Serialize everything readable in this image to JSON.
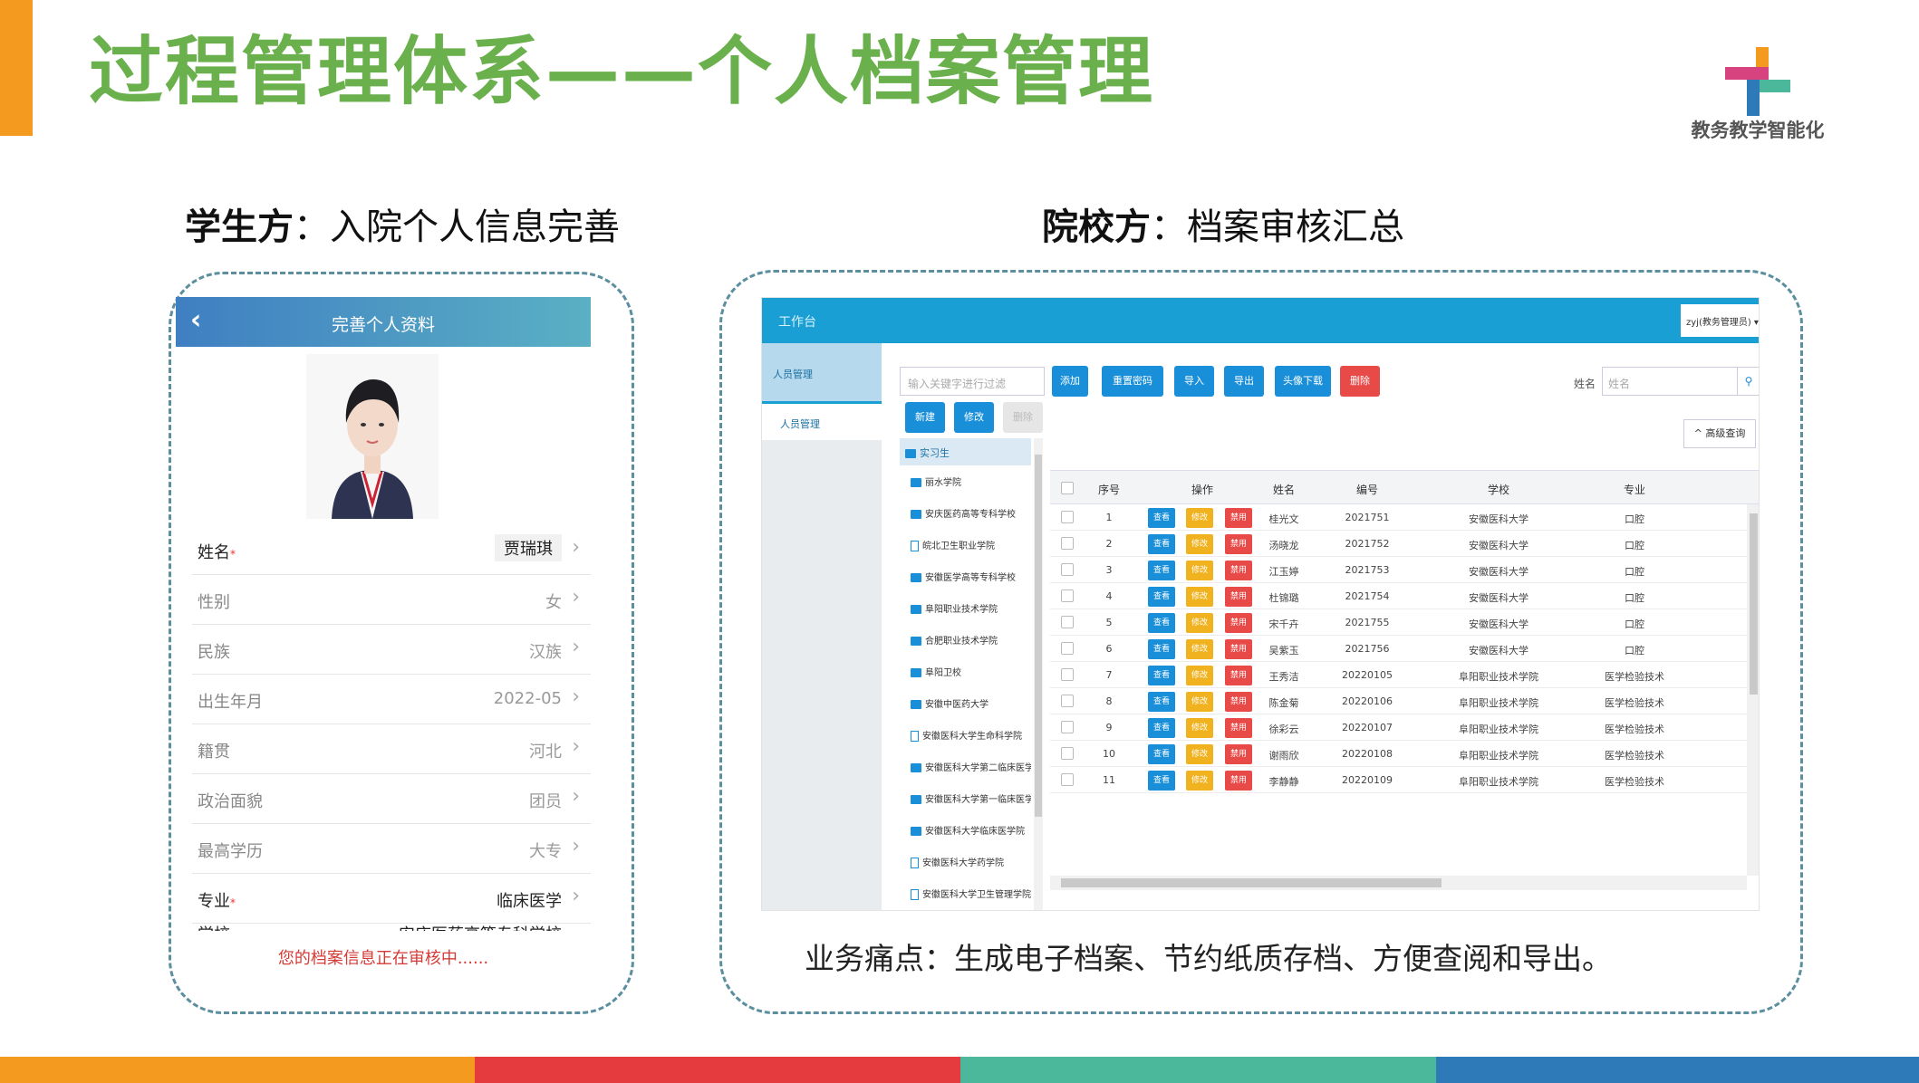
{
  "slide": {
    "title": "过程管理体系——个人档案管理",
    "logo_text": "教务教学智能化",
    "student_head_bold": "学生方",
    "student_head_rest": "：入院个人信息完善",
    "school_head_bold": "院校方",
    "school_head_rest": "：档案审核汇总",
    "pain_points": "业务痛点：生成电子档案、节约纸质存档、方便查阅和导出。",
    "accent_colors": [
      "#f39a1f",
      "#e63b3e",
      "#4bb89b",
      "#2e7ab8"
    ],
    "title_color": "#6ab04c"
  },
  "phone": {
    "back_icon": "chevron-left-icon",
    "header_title": "完善个人资料",
    "fields": [
      {
        "label": "姓名",
        "required": "*",
        "value": "贾瑞琪"
      },
      {
        "label": "性别",
        "required": "",
        "value": "女"
      },
      {
        "label": "民族",
        "required": "",
        "value": "汉族"
      },
      {
        "label": "出生年月",
        "required": "",
        "value": "2022-05"
      },
      {
        "label": "籍贯",
        "required": "",
        "value": "河北"
      },
      {
        "label": "政治面貌",
        "required": "",
        "value": "团员"
      },
      {
        "label": "最高学历",
        "required": "",
        "value": "大专"
      },
      {
        "label": "专业",
        "required": "*",
        "value": "临床医学"
      },
      {
        "label": "学校",
        "required": "*",
        "value": "安庆医药高等专科学校"
      }
    ],
    "notice": "您的档案信息正在审核中......"
  },
  "admin": {
    "topbar_title": "工作台",
    "user_menu": "zyj(教务管理员) ▾",
    "sidebar_header": "人员管理",
    "sidebar_item": "人员管理",
    "search_placeholder": "输入关键字进行过滤",
    "buttons": {
      "add": "添加",
      "reset_password": "重置密码",
      "import": "导入",
      "export": "导出",
      "avatar_download": "头像下载",
      "delete": "删除",
      "new": "新建",
      "modify": "修改",
      "remove": "删除"
    },
    "name_label": "姓名",
    "name_placeholder": "姓名",
    "advanced_query": "^ 高级查询",
    "tree_root": "实习生",
    "tree_nodes": [
      {
        "label": "丽水学院",
        "icon": "folder"
      },
      {
        "label": "安庆医药高等专科学校",
        "icon": "folder"
      },
      {
        "label": "皖北卫生职业学院",
        "icon": "file"
      },
      {
        "label": "安徽医学高等专科学校",
        "icon": "folder"
      },
      {
        "label": "阜阳职业技术学院",
        "icon": "folder"
      },
      {
        "label": "合肥职业技术学院",
        "icon": "folder"
      },
      {
        "label": "阜阳卫校",
        "icon": "folder"
      },
      {
        "label": "安徽中医药大学",
        "icon": "folder"
      },
      {
        "label": "安徽医科大学生命科学院",
        "icon": "file"
      },
      {
        "label": "安徽医科大学第二临床医学院",
        "icon": "folder"
      },
      {
        "label": "安徽医科大学第一临床医学院",
        "icon": "folder"
      },
      {
        "label": "安徽医科大学临床医学院",
        "icon": "folder"
      },
      {
        "label": "安徽医科大学药学院",
        "icon": "file"
      },
      {
        "label": "安徽医科大学卫生管理学院",
        "icon": "file"
      }
    ],
    "table": {
      "columns": [
        "序号",
        "操作",
        "姓名",
        "编号",
        "学校",
        "专业"
      ],
      "action_labels": {
        "view": "查看",
        "edit": "修改",
        "ban": "禁用"
      },
      "rows": [
        {
          "no": "1",
          "name": "桂光文",
          "id": "2021751",
          "school": "安徽医科大学",
          "major": "口腔"
        },
        {
          "no": "2",
          "name": "汤晓龙",
          "id": "2021752",
          "school": "安徽医科大学",
          "major": "口腔"
        },
        {
          "no": "3",
          "name": "江玉婷",
          "id": "2021753",
          "school": "安徽医科大学",
          "major": "口腔"
        },
        {
          "no": "4",
          "name": "杜锦璐",
          "id": "2021754",
          "school": "安徽医科大学",
          "major": "口腔"
        },
        {
          "no": "5",
          "name": "宋千卉",
          "id": "2021755",
          "school": "安徽医科大学",
          "major": "口腔"
        },
        {
          "no": "6",
          "name": "吴紫玉",
          "id": "2021756",
          "school": "安徽医科大学",
          "major": "口腔"
        },
        {
          "no": "7",
          "name": "王秀洁",
          "id": "20220105",
          "school": "阜阳职业技术学院",
          "major": "医学检验技术"
        },
        {
          "no": "8",
          "name": "陈金菊",
          "id": "20220106",
          "school": "阜阳职业技术学院",
          "major": "医学检验技术"
        },
        {
          "no": "9",
          "name": "徐彩云",
          "id": "20220107",
          "school": "阜阳职业技术学院",
          "major": "医学检验技术"
        },
        {
          "no": "10",
          "name": "谢雨欣",
          "id": "20220108",
          "school": "阜阳职业技术学院",
          "major": "医学检验技术"
        },
        {
          "no": "11",
          "name": "李静静",
          "id": "20220109",
          "school": "阜阳职业技术学院",
          "major": "医学检验技术"
        }
      ]
    }
  }
}
